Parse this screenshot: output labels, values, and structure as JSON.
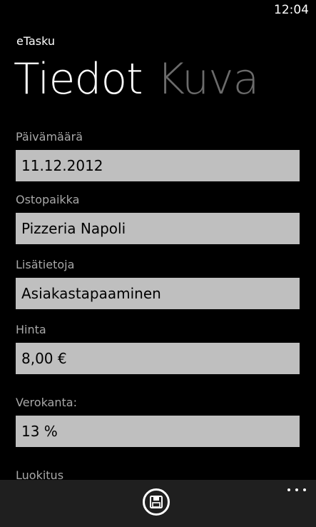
{
  "status_bar": {
    "time": "12:04"
  },
  "app": {
    "title": "eTasku"
  },
  "pivot": {
    "active": "Tiedot",
    "inactive": "Kuva"
  },
  "fields": [
    {
      "label": "Päivämäärä",
      "value": "11.12.2012"
    },
    {
      "label": "Ostopaikka",
      "value": "Pizzeria Napoli"
    },
    {
      "label": "Lisätietoja",
      "value": "Asiakastapaaminen"
    },
    {
      "label": "Hinta",
      "value": "8,00 €"
    },
    {
      "label": "Verokanta:",
      "value": "13 %"
    },
    {
      "label": "Luokitus"
    }
  ],
  "app_bar": {
    "save_icon": "save-icon",
    "more_icon": "more-icon"
  },
  "colors": {
    "background": "#000000",
    "input_background": "#bfbfbf",
    "label": "#a8a8a8",
    "pivot_inactive": "#6b6b6b",
    "app_bar": "#1f1f1f"
  }
}
